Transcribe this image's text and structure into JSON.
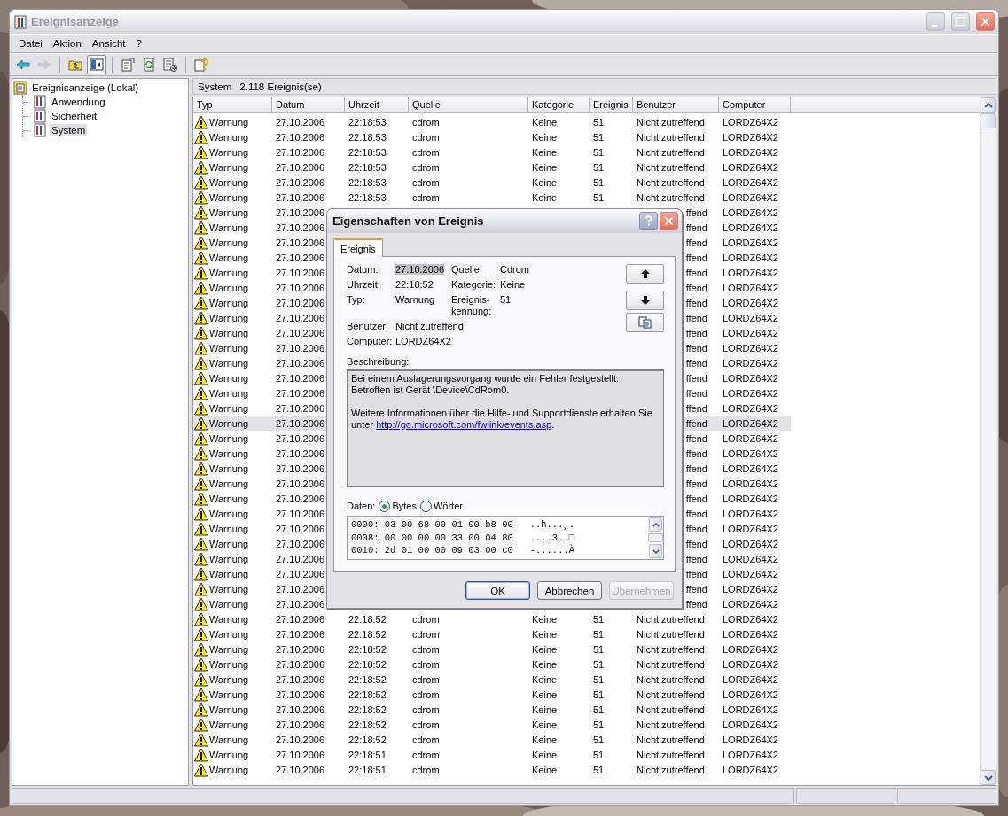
{
  "window": {
    "title": "Ereignisanzeige"
  },
  "menu": [
    "Datei",
    "Aktion",
    "Ansicht",
    "?"
  ],
  "toolbar": [
    {
      "kind": "back",
      "disabled": false,
      "pressed": false
    },
    {
      "kind": "forward",
      "disabled": true,
      "pressed": false
    },
    {
      "kind": "separator"
    },
    {
      "kind": "up",
      "disabled": false,
      "pressed": false
    },
    {
      "kind": "tree",
      "disabled": false,
      "pressed": true
    },
    {
      "kind": "separator"
    },
    {
      "kind": "properties",
      "disabled": false,
      "pressed": false
    },
    {
      "kind": "refresh",
      "disabled": false,
      "pressed": false
    },
    {
      "kind": "export",
      "disabled": false,
      "pressed": false
    },
    {
      "kind": "separator"
    },
    {
      "kind": "help",
      "disabled": false,
      "pressed": false
    }
  ],
  "tree": {
    "label": "Ereignisanzeige (Lokal)",
    "children": [
      {
        "label": "Anwendung",
        "selected": false
      },
      {
        "label": "Sicherheit",
        "selected": false
      },
      {
        "label": "System",
        "selected": true
      }
    ]
  },
  "list": {
    "title": "System",
    "count": "2.118 Ereignis(se)",
    "columns": [
      "Typ",
      "Datum",
      "Uhrzeit",
      "Quelle",
      "Kategorie",
      "Ereignis",
      "Benutzer",
      "Computer"
    ],
    "rows": [
      {
        "kind": "full",
        "type": "Warnung",
        "date": "27.10.2006",
        "time": "22:18:53",
        "source": "cdrom",
        "category": "Keine",
        "event": "51",
        "user": "Nicht zutreffend",
        "computer": "LORDZ64X2",
        "selected": false
      },
      {
        "kind": "full",
        "type": "Warnung",
        "date": "27.10.2006",
        "time": "22:18:53",
        "source": "cdrom",
        "category": "Keine",
        "event": "51",
        "user": "Nicht zutreffend",
        "computer": "LORDZ64X2",
        "selected": false
      },
      {
        "kind": "full",
        "type": "Warnung",
        "date": "27.10.2006",
        "time": "22:18:53",
        "source": "cdrom",
        "category": "Keine",
        "event": "51",
        "user": "Nicht zutreffend",
        "computer": "LORDZ64X2",
        "selected": false
      },
      {
        "kind": "full",
        "type": "Warnung",
        "date": "27.10.2006",
        "time": "22:18:53",
        "source": "cdrom",
        "category": "Keine",
        "event": "51",
        "user": "Nicht zutreffend",
        "computer": "LORDZ64X2",
        "selected": false
      },
      {
        "kind": "full",
        "type": "Warnung",
        "date": "27.10.2006",
        "time": "22:18:53",
        "source": "cdrom",
        "category": "Keine",
        "event": "51",
        "user": "Nicht zutreffend",
        "computer": "LORDZ64X2",
        "selected": false
      },
      {
        "kind": "full",
        "type": "Warnung",
        "date": "27.10.2006",
        "time": "22:18:53",
        "source": "cdrom",
        "category": "Keine",
        "event": "51",
        "user": "Nicht zutreffend",
        "computer": "LORDZ64X2",
        "selected": false
      },
      {
        "kind": "covered",
        "type": "Warnung",
        "date": "27.10.2006",
        "user": "ffend",
        "computer": "LORDZ64X2",
        "selected": false
      },
      {
        "kind": "covered",
        "type": "Warnung",
        "date": "27.10.2006",
        "user": "ffend",
        "computer": "LORDZ64X2",
        "selected": false
      },
      {
        "kind": "covered",
        "type": "Warnung",
        "date": "27.10.2006",
        "user": "ffend",
        "computer": "LORDZ64X2",
        "selected": false
      },
      {
        "kind": "covered",
        "type": "Warnung",
        "date": "27.10.2006",
        "user": "ffend",
        "computer": "LORDZ64X2",
        "selected": false
      },
      {
        "kind": "covered",
        "type": "Warnung",
        "date": "27.10.2006",
        "user": "ffend",
        "computer": "LORDZ64X2",
        "selected": false
      },
      {
        "kind": "covered",
        "type": "Warnung",
        "date": "27.10.2006",
        "user": "ffend",
        "computer": "LORDZ64X2",
        "selected": false
      },
      {
        "kind": "covered",
        "type": "Warnung",
        "date": "27.10.2006",
        "user": "ffend",
        "computer": "LORDZ64X2",
        "selected": false
      },
      {
        "kind": "covered",
        "type": "Warnung",
        "date": "27.10.2006",
        "user": "ffend",
        "computer": "LORDZ64X2",
        "selected": false
      },
      {
        "kind": "covered",
        "type": "Warnung",
        "date": "27.10.2006",
        "user": "ffend",
        "computer": "LORDZ64X2",
        "selected": false
      },
      {
        "kind": "covered",
        "type": "Warnung",
        "date": "27.10.2006",
        "user": "ffend",
        "computer": "LORDZ64X2",
        "selected": false
      },
      {
        "kind": "covered",
        "type": "Warnung",
        "date": "27.10.2006",
        "user": "ffend",
        "computer": "LORDZ64X2",
        "selected": false
      },
      {
        "kind": "covered",
        "type": "Warnung",
        "date": "27.10.2006",
        "user": "ffend",
        "computer": "LORDZ64X2",
        "selected": false
      },
      {
        "kind": "covered",
        "type": "Warnung",
        "date": "27.10.2006",
        "user": "ffend",
        "computer": "LORDZ64X2",
        "selected": false
      },
      {
        "kind": "covered",
        "type": "Warnung",
        "date": "27.10.2006",
        "user": "ffend",
        "computer": "LORDZ64X2",
        "selected": false
      },
      {
        "kind": "covered",
        "type": "Warnung",
        "date": "27.10.2006",
        "user": "ffend",
        "computer": "LORDZ64X2",
        "selected": true
      },
      {
        "kind": "covered",
        "type": "Warnung",
        "date": "27.10.2006",
        "user": "ffend",
        "computer": "LORDZ64X2",
        "selected": false
      },
      {
        "kind": "covered",
        "type": "Warnung",
        "date": "27.10.2006",
        "user": "ffend",
        "computer": "LORDZ64X2",
        "selected": false
      },
      {
        "kind": "covered",
        "type": "Warnung",
        "date": "27.10.2006",
        "user": "ffend",
        "computer": "LORDZ64X2",
        "selected": false
      },
      {
        "kind": "covered",
        "type": "Warnung",
        "date": "27.10.2006",
        "user": "ffend",
        "computer": "LORDZ64X2",
        "selected": false
      },
      {
        "kind": "covered",
        "type": "Warnung",
        "date": "27.10.2006",
        "user": "ffend",
        "computer": "LORDZ64X2",
        "selected": false
      },
      {
        "kind": "covered",
        "type": "Warnung",
        "date": "27.10.2006",
        "user": "ffend",
        "computer": "LORDZ64X2",
        "selected": false
      },
      {
        "kind": "covered",
        "type": "Warnung",
        "date": "27.10.2006",
        "user": "ffend",
        "computer": "LORDZ64X2",
        "selected": false
      },
      {
        "kind": "covered",
        "type": "Warnung",
        "date": "27.10.2006",
        "user": "ffend",
        "computer": "LORDZ64X2",
        "selected": false
      },
      {
        "kind": "covered",
        "type": "Warnung",
        "date": "27.10.2006",
        "user": "ffend",
        "computer": "LORDZ64X2",
        "selected": false
      },
      {
        "kind": "covered",
        "type": "Warnung",
        "date": "27.10.2006",
        "user": "ffend",
        "computer": "LORDZ64X2",
        "selected": false
      },
      {
        "kind": "covered",
        "type": "Warnung",
        "date": "27.10.2006",
        "user": "ffend",
        "computer": "LORDZ64X2",
        "selected": false
      },
      {
        "kind": "covered",
        "type": "Warnung",
        "date": "27.10.2006",
        "user": "ffend",
        "computer": "LORDZ64X2",
        "selected": false
      },
      {
        "kind": "full",
        "type": "Warnung",
        "date": "27.10.2006",
        "time": "22:18:52",
        "source": "cdrom",
        "category": "Keine",
        "event": "51",
        "user": "Nicht zutreffend",
        "computer": "LORDZ64X2",
        "selected": false
      },
      {
        "kind": "full",
        "type": "Warnung",
        "date": "27.10.2006",
        "time": "22:18:52",
        "source": "cdrom",
        "category": "Keine",
        "event": "51",
        "user": "Nicht zutreffend",
        "computer": "LORDZ64X2",
        "selected": false
      },
      {
        "kind": "full",
        "type": "Warnung",
        "date": "27.10.2006",
        "time": "22:18:52",
        "source": "cdrom",
        "category": "Keine",
        "event": "51",
        "user": "Nicht zutreffend",
        "computer": "LORDZ64X2",
        "selected": false
      },
      {
        "kind": "full",
        "type": "Warnung",
        "date": "27.10.2006",
        "time": "22:18:52",
        "source": "cdrom",
        "category": "Keine",
        "event": "51",
        "user": "Nicht zutreffend",
        "computer": "LORDZ64X2",
        "selected": false
      },
      {
        "kind": "full",
        "type": "Warnung",
        "date": "27.10.2006",
        "time": "22:18:52",
        "source": "cdrom",
        "category": "Keine",
        "event": "51",
        "user": "Nicht zutreffend",
        "computer": "LORDZ64X2",
        "selected": false
      },
      {
        "kind": "full",
        "type": "Warnung",
        "date": "27.10.2006",
        "time": "22:18:52",
        "source": "cdrom",
        "category": "Keine",
        "event": "51",
        "user": "Nicht zutreffend",
        "computer": "LORDZ64X2",
        "selected": false
      },
      {
        "kind": "full",
        "type": "Warnung",
        "date": "27.10.2006",
        "time": "22:18:52",
        "source": "cdrom",
        "category": "Keine",
        "event": "51",
        "user": "Nicht zutreffend",
        "computer": "LORDZ64X2",
        "selected": false
      },
      {
        "kind": "full",
        "type": "Warnung",
        "date": "27.10.2006",
        "time": "22:18:52",
        "source": "cdrom",
        "category": "Keine",
        "event": "51",
        "user": "Nicht zutreffend",
        "computer": "LORDZ64X2",
        "selected": false
      },
      {
        "kind": "full",
        "type": "Warnung",
        "date": "27.10.2006",
        "time": "22:18:52",
        "source": "cdrom",
        "category": "Keine",
        "event": "51",
        "user": "Nicht zutreffend",
        "computer": "LORDZ64X2",
        "selected": false
      },
      {
        "kind": "full",
        "type": "Warnung",
        "date": "27.10.2006",
        "time": "22:18:51",
        "source": "cdrom",
        "category": "Keine",
        "event": "51",
        "user": "Nicht zutreffend",
        "computer": "LORDZ64X2",
        "selected": false
      },
      {
        "kind": "full",
        "type": "Warnung",
        "date": "27.10.2006",
        "time": "22:18:51",
        "source": "cdrom",
        "category": "Keine",
        "event": "51",
        "user": "Nicht zutreffend",
        "computer": "LORDZ64X2",
        "selected": false
      }
    ]
  },
  "dialog": {
    "title": "Eigenschaften von Ereignis",
    "tabs": [
      {
        "label": "Ereignis",
        "selected": true
      }
    ],
    "fields": [
      {
        "kind": "pair",
        "label": "Datum:",
        "value": "27.10.2006",
        "highlighted": true
      },
      {
        "kind": "pair",
        "label": "Quelle:",
        "value": "Cdrom",
        "highlighted": false
      },
      {
        "kind": "pair",
        "label": "Uhrzeit:",
        "value": "22:18:52",
        "highlighted": false
      },
      {
        "kind": "pair",
        "label": "Kategorie:",
        "value": "Keine",
        "highlighted": false
      },
      {
        "kind": "pair",
        "label": "Typ:",
        "value": "Warnung",
        "highlighted": false
      },
      {
        "kind": "pair",
        "label": "Ereignis-\nkennung:",
        "value": "51",
        "highlighted": false
      },
      {
        "kind": "wide",
        "label": "Benutzer:",
        "value": "Nicht zutreffend",
        "highlighted": false
      },
      {
        "kind": "wide",
        "label": "Computer:",
        "value": "LORDZ64X2",
        "highlighted": false
      }
    ],
    "description": {
      "label": "Beschreibung:",
      "text": "Bei einem Auslagerungsvorgang wurde ein Fehler festgestellt. Betroffen ist Gerät \\Device\\CdRom0.",
      "info": "Weitere Informationen über die Hilfe- und Supportdienste erhalten Sie unter",
      "link": "http://go.microsoft.com/fwlink/events.asp",
      "tail": "."
    },
    "data": {
      "label": "Daten:",
      "options": [
        {
          "label": "Bytes",
          "selected": true
        },
        {
          "label": "Wörter",
          "selected": false
        }
      ],
      "lines": [
        "0000: 03 00 68 00 01 00 b8 00   ..h...¸.",
        "0008: 00 00 00 00 33 00 04 80   ....3..□",
        "0010: 2d 01 00 00 09 03 00 c0   -......À"
      ]
    },
    "buttons": [
      {
        "label": "OK",
        "default": true,
        "disabled": false
      },
      {
        "label": "Abbrechen",
        "default": false,
        "disabled": false
      },
      {
        "label": "Übernehmen",
        "default": false,
        "disabled": true
      }
    ]
  }
}
